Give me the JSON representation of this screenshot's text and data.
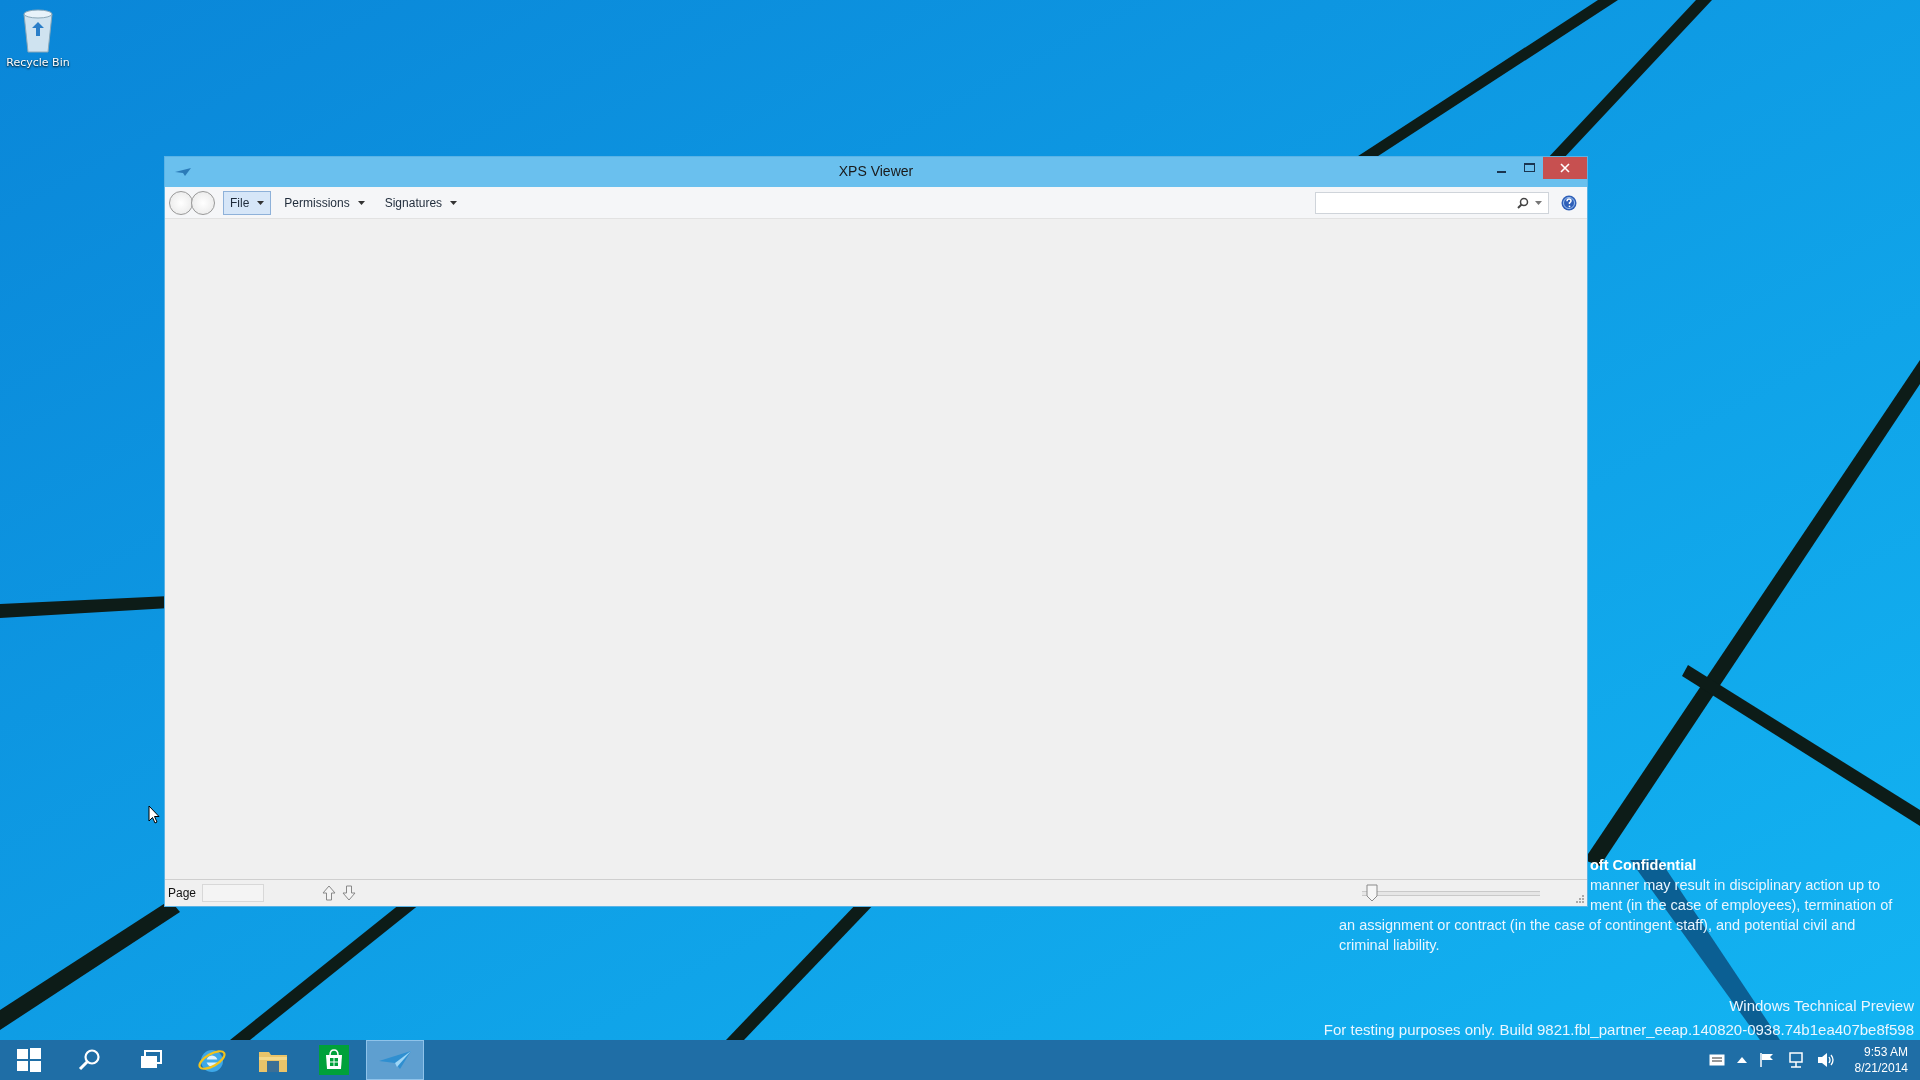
{
  "desktop_icons": [
    {
      "label": "Recycle Bin"
    }
  ],
  "window": {
    "title": "XPS Viewer",
    "menu": [
      {
        "label": "File",
        "selected": true
      },
      {
        "label": "Permissions",
        "selected": false
      },
      {
        "label": "Signatures",
        "selected": false
      }
    ],
    "status_bar": {
      "page_label": "Page",
      "zoom": {
        "level": 0.02
      }
    }
  },
  "confidential_notice": [
    {
      "text": "oft Confidential",
      "bold": true
    },
    {
      "text": "manner may result in disciplinary action up to",
      "bold": false
    },
    {
      "text": "ment (in the case of employees), termination of",
      "bold": false
    },
    {
      "text": "an assignment or contract (in the case of contingent staff), and potential civil and",
      "bold": false
    },
    {
      "text": "criminal liability.",
      "bold": false
    }
  ],
  "build_info": [
    "Windows Technical Preview",
    "For testing purposes only. Build 9821.fbl_partner_eeap.140820-0938.74b1ea407be8f598"
  ],
  "taskbar": {
    "apps": [
      {
        "kind": "start",
        "selected": false
      },
      {
        "kind": "search",
        "selected": false
      },
      {
        "kind": "taskview",
        "selected": false
      },
      {
        "kind": "browser",
        "selected": false
      },
      {
        "kind": "folder",
        "selected": false
      },
      {
        "kind": "store",
        "selected": false
      },
      {
        "kind": "xps",
        "selected": true
      }
    ],
    "time": "9:53 AM",
    "date": "8/21/2014"
  }
}
